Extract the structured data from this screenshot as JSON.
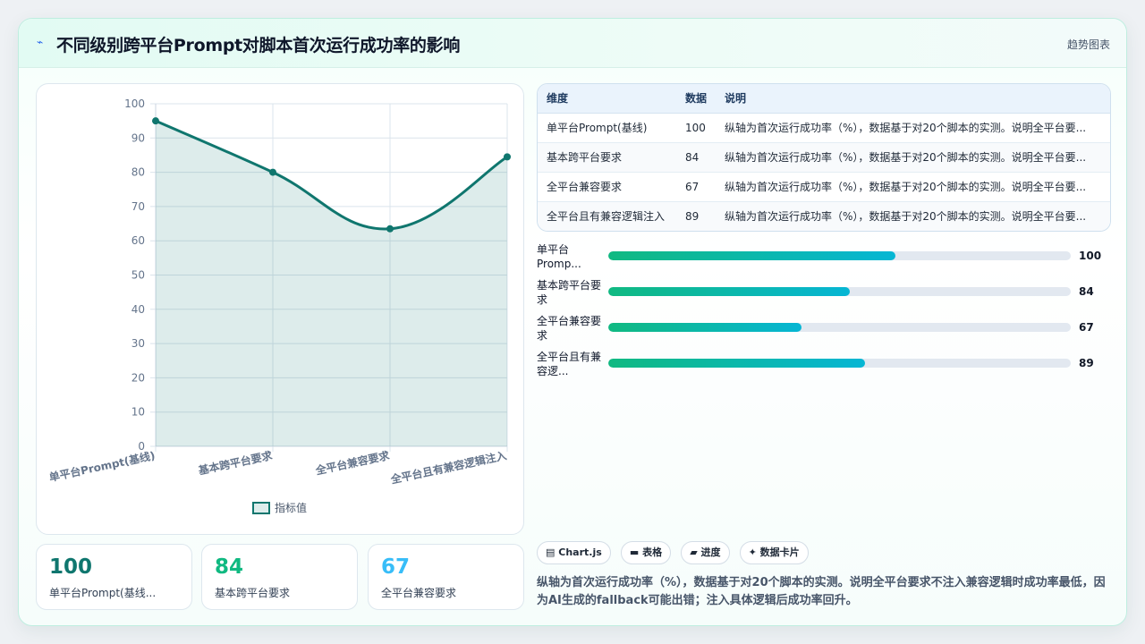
{
  "header": {
    "icon": "pulse-icon",
    "title": "不同级别跨平台Prompt对脚本首次运行成功率的影响",
    "tag": "趋势图表"
  },
  "chart_data": {
    "type": "line",
    "categories": [
      "单平台Prompt(基线)",
      "基本跨平台要求",
      "全平台兼容要求",
      "全平台且有兼容逻辑注入"
    ],
    "series": [
      {
        "name": "指标值",
        "values": [
          95,
          80,
          63.5,
          84.5
        ]
      }
    ],
    "ylim": [
      0,
      100
    ],
    "yticks": [
      0,
      10,
      20,
      30,
      40,
      50,
      60,
      70,
      80,
      90,
      100
    ],
    "grid": true,
    "legend": "bottom",
    "color": "#0f766e"
  },
  "stats": [
    {
      "value": "100",
      "label": "单平台Prompt(基线...",
      "color": "#0f766e"
    },
    {
      "value": "84",
      "label": "基本跨平台要求",
      "color": "#10b981"
    },
    {
      "value": "67",
      "label": "全平台兼容要求",
      "color": "#38bdf8"
    }
  ],
  "table": {
    "headers": [
      "维度",
      "数据",
      "说明"
    ],
    "rows": [
      [
        "单平台Prompt(基线)",
        "100",
        "纵轴为首次运行成功率（%），数据基于对20个脚本的实测。说明全平台要..."
      ],
      [
        "基本跨平台要求",
        "84",
        "纵轴为首次运行成功率（%），数据基于对20个脚本的实测。说明全平台要..."
      ],
      [
        "全平台兼容要求",
        "67",
        "纵轴为首次运行成功率（%），数据基于对20个脚本的实测。说明全平台要..."
      ],
      [
        "全平台且有兼容逻辑注入",
        "89",
        "纵轴为首次运行成功率（%），数据基于对20个脚本的实测。说明全平台要..."
      ]
    ]
  },
  "progress": [
    {
      "label": "单平台Promp...",
      "value": 100,
      "fraction": 0.62
    },
    {
      "label": "基本跨平台要求",
      "value": 84,
      "fraction": 0.523
    },
    {
      "label": "全平台兼容要求",
      "value": 67,
      "fraction": 0.417
    },
    {
      "label": "全平台且有兼容逻...",
      "value": 89,
      "fraction": 0.555
    }
  ],
  "chips": [
    {
      "icon": "chart-icon",
      "glyph": "▤",
      "label": "Chart.js"
    },
    {
      "icon": "table-icon",
      "glyph": "▬",
      "label": "表格"
    },
    {
      "icon": "progress-icon",
      "glyph": "▰",
      "label": "进度"
    },
    {
      "icon": "sparkle-icon",
      "glyph": "✦",
      "label": "数据卡片"
    }
  ],
  "note": "纵轴为首次运行成功率（%），数据基于对20个脚本的实测。说明全平台要求不注入兼容逻辑时成功率最低，因为AI生成的fallback可能出错；注入具体逻辑后成功率回升。"
}
